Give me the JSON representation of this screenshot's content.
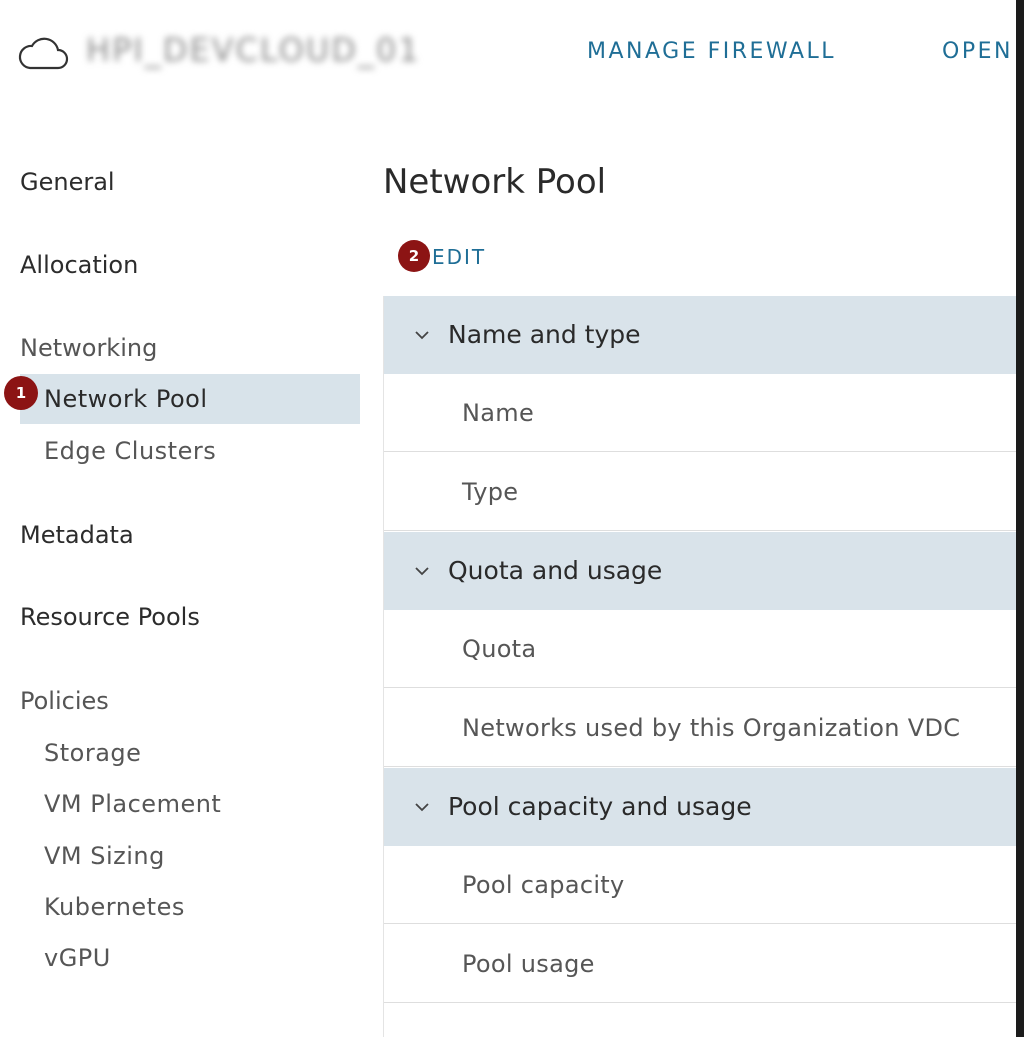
{
  "header": {
    "org_name": "HPI_DEVCLOUD_01",
    "links": [
      "MANAGE FIREWALL",
      "OPEN"
    ]
  },
  "sidebar": {
    "general": "General",
    "allocation": "Allocation",
    "networking": {
      "label": "Networking",
      "items": [
        "Network Pool",
        "Edge Clusters"
      ],
      "active": "Network Pool"
    },
    "metadata": "Metadata",
    "resource_pools": "Resource Pools",
    "policies": {
      "label": "Policies",
      "items": [
        "Storage",
        "VM Placement",
        "VM Sizing",
        "Kubernetes",
        "vGPU"
      ]
    }
  },
  "callouts": [
    "1",
    "2"
  ],
  "main": {
    "title": "Network Pool",
    "edit_label": "EDIT",
    "sections": [
      {
        "label": "Name and type",
        "rows": [
          "Name",
          "Type"
        ]
      },
      {
        "label": "Quota and usage",
        "rows": [
          "Quota",
          "Networks used by this Organization VDC"
        ]
      },
      {
        "label": "Pool capacity and usage",
        "rows": [
          "Pool capacity",
          "Pool usage"
        ]
      }
    ]
  },
  "colors": {
    "accent_link": "#1f6e96",
    "section_bg": "#d9e3ea",
    "selected_bg": "#d8e3ea",
    "callout": "#8c1414"
  }
}
